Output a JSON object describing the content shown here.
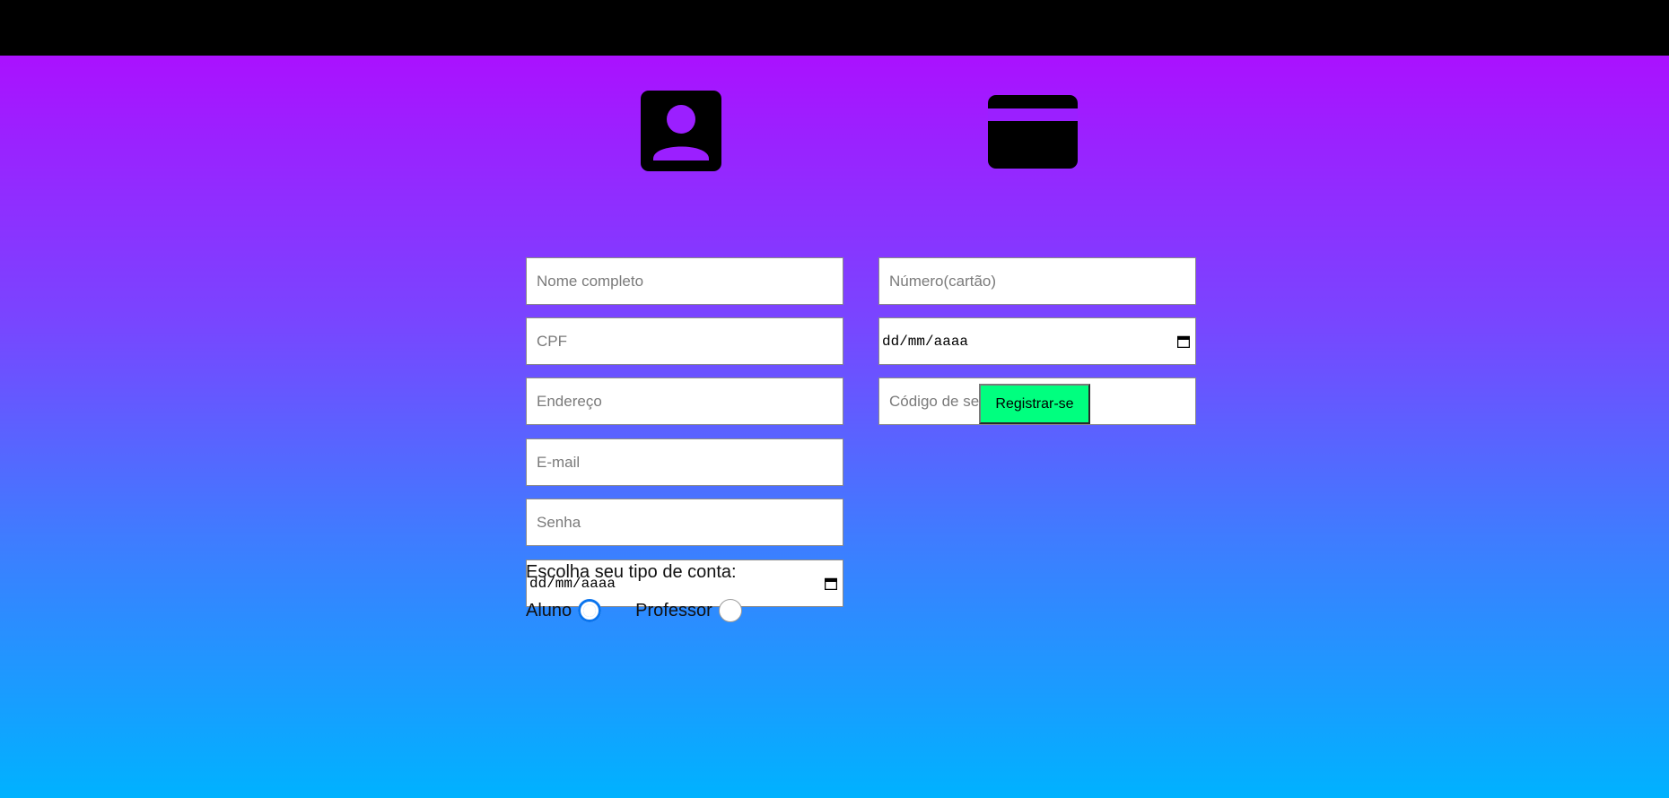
{
  "form": {
    "left_fields": [
      {
        "placeholder": "Nome completo"
      },
      {
        "placeholder": "CPF"
      },
      {
        "placeholder": "Endereço"
      },
      {
        "placeholder": "E-mail"
      },
      {
        "placeholder": "Senha"
      }
    ],
    "birth_date": {
      "placeholder": "dd/mm/aaaa"
    },
    "card_number": {
      "placeholder": "Número(cartão)"
    },
    "card_expiry": {
      "placeholder": "dd/mm/aaaa"
    },
    "card_security": {
      "placeholder": "Código de segurança(cartão)"
    },
    "register_label": "Registrar-se",
    "account_type_label": "Escolha seu tipo de conta:",
    "account_options": [
      {
        "label": "Aluno",
        "checked": true
      },
      {
        "label": "Professor",
        "checked": false
      }
    ]
  },
  "icons": {
    "user": "account-box-icon",
    "card": "credit-card-icon",
    "calendar": "calendar-icon"
  },
  "colors": {
    "topbar": "#000000",
    "gradient_top": "#aa11ff",
    "gradient_bottom": "#00b2ff",
    "register_button": "#00ff7f",
    "radio_accent": "#0a74ee"
  }
}
